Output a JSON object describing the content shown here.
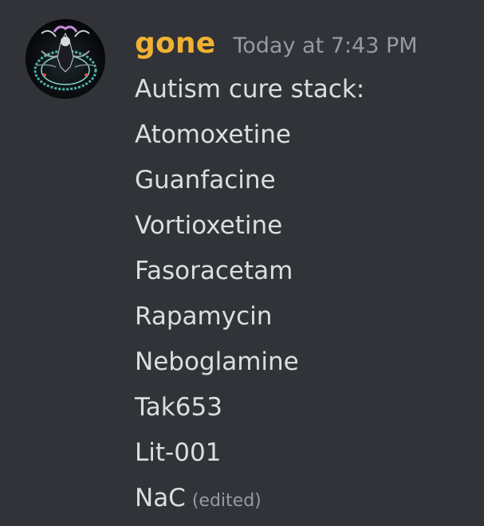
{
  "message": {
    "author": {
      "username": "gone",
      "name_color": "#f0b232",
      "avatar_icon": "avatar-image"
    },
    "timestamp": "Today at 7:43 PM",
    "lines": [
      "Autism cure stack:",
      "Atomoxetine",
      "Guanfacine",
      "Vortioxetine",
      "Fasoracetam",
      "Rapamycin",
      "Neboglamine",
      "Tak653",
      "Lit-001",
      "NaC"
    ],
    "edited_label": "(edited)"
  },
  "colors": {
    "background": "#313338",
    "text": "#dbdee1",
    "muted": "#949ba4"
  }
}
